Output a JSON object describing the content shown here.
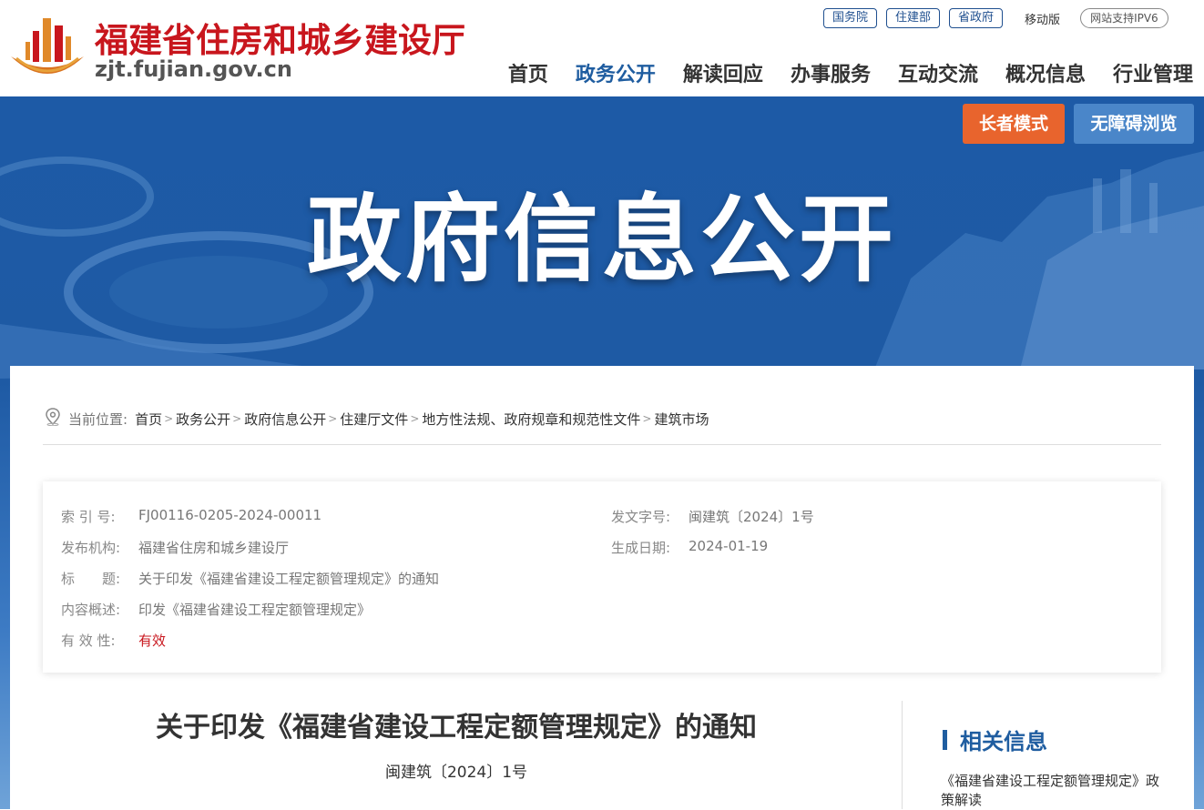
{
  "header": {
    "site_name": "福建省住房和城乡建设厅",
    "domain": "zjt.fujian.gov.cn",
    "top_links": [
      "国务院",
      "住建部",
      "省政府"
    ],
    "mobile_label": "移动版",
    "ipv6_label": "网站支持IPV6",
    "nav": [
      "首页",
      "政务公开",
      "解读回应",
      "办事服务",
      "互动交流",
      "概况信息",
      "行业管理"
    ]
  },
  "banner": {
    "title": "政府信息公开",
    "elder_mode": "长者模式",
    "accessible": "无障碍浏览"
  },
  "breadcrumb": {
    "label": "当前位置:",
    "items": [
      "首页",
      "政务公开",
      "政府信息公开",
      "住建厅文件",
      "地方性法规、政府规章和规范性文件",
      "建筑市场"
    ]
  },
  "meta": {
    "index_key": "索 引 号:",
    "index_val": "FJ00116-0205-2024-00011",
    "doc_num_key": "发文字号:",
    "doc_num_val": "闽建筑〔2024〕1号",
    "org_key": "发布机构:",
    "org_val": "福建省住房和城乡建设厅",
    "date_key": "生成日期:",
    "date_val": "2024-01-19",
    "title_key": "标　　题:",
    "title_val": "关于印发《福建省建设工程定额管理规定》的通知",
    "summary_key": "内容概述:",
    "summary_val": "印发《福建省建设工程定额管理规定》",
    "validity_key": "有 效 性:",
    "validity_val": "有效"
  },
  "article": {
    "title": "关于印发《福建省建设工程定额管理规定》的通知",
    "doc_number": "闽建筑〔2024〕1号"
  },
  "related": {
    "title": "相关信息",
    "link": "《福建省建设工程定额管理规定》政策解读"
  },
  "colors": {
    "brand_red": "#c8161d",
    "brand_blue": "#1f5da0",
    "elder_orange": "#e8642d",
    "accessible_blue": "#4a86c9"
  }
}
